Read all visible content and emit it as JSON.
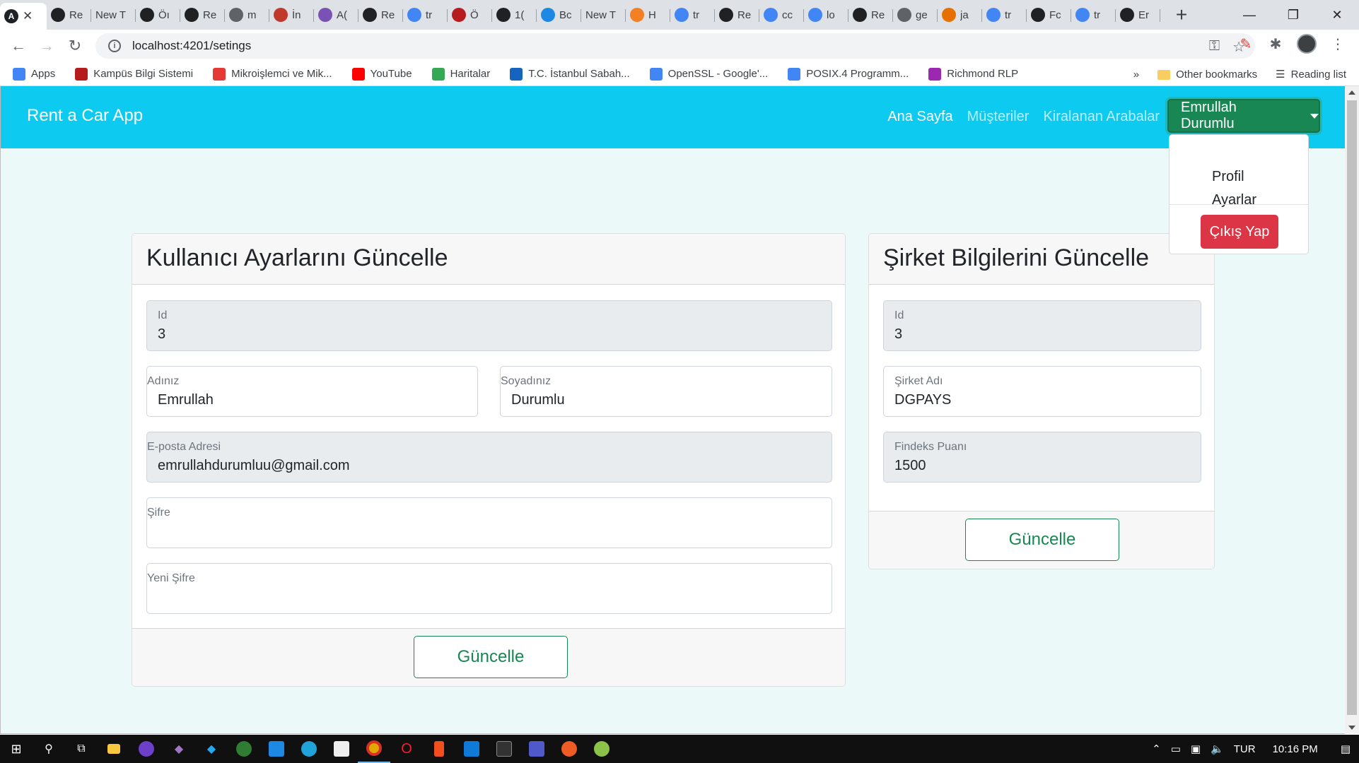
{
  "browser": {
    "tabs": [
      {
        "icon": "angular-icon",
        "label": "",
        "active": true
      },
      {
        "icon": "angular-icon",
        "label": "Re"
      },
      {
        "icon": "",
        "label": "New T"
      },
      {
        "icon": "frame-icon",
        "label": "Öı"
      },
      {
        "icon": "github-icon",
        "label": "Re"
      },
      {
        "icon": "globe-icon",
        "label": "m"
      },
      {
        "icon": "udemy-icon",
        "label": "İn"
      },
      {
        "icon": "bootstrap-icon",
        "label": "A("
      },
      {
        "icon": "angular-icon",
        "label": "Re"
      },
      {
        "icon": "google-icon",
        "label": "tr"
      },
      {
        "icon": "university-icon",
        "label": "Ö"
      },
      {
        "icon": "f-icon",
        "label": "1("
      },
      {
        "icon": "bd-icon",
        "label": "Bc"
      },
      {
        "icon": "",
        "label": "New T"
      },
      {
        "icon": "stack-icon",
        "label": "H"
      },
      {
        "icon": "google-icon",
        "label": "tr"
      },
      {
        "icon": "angular-icon",
        "label": "Re"
      },
      {
        "icon": "google-icon",
        "label": "cc"
      },
      {
        "icon": "google-icon",
        "label": "lo"
      },
      {
        "icon": "angular-icon",
        "label": "Re"
      },
      {
        "icon": "globe-icon",
        "label": "ge"
      },
      {
        "icon": "java-icon",
        "label": "ja"
      },
      {
        "icon": "google-icon",
        "label": "tr"
      },
      {
        "icon": "record-icon",
        "label": "Fc"
      },
      {
        "icon": "google-icon",
        "label": "tr"
      },
      {
        "icon": "angular-icon",
        "label": "Er"
      }
    ],
    "new_tab": "+",
    "url": "localhost:4201/setings",
    "bookmarks": [
      {
        "icon": "apps-icon",
        "label": "Apps"
      },
      {
        "icon": "university-icon",
        "label": "Kampüs Bilgi Sistemi"
      },
      {
        "icon": "chip-icon",
        "label": "Mikroişlemci ve Mik..."
      },
      {
        "icon": "youtube-icon",
        "label": "YouTube"
      },
      {
        "icon": "maps-icon",
        "label": "Haritalar"
      },
      {
        "icon": "otm-icon",
        "label": "T.C. İstanbul Sabah..."
      },
      {
        "icon": "google-icon",
        "label": "OpenSSL - Google'..."
      },
      {
        "icon": "google-icon",
        "label": "POSIX.4 Programm..."
      },
      {
        "icon": "richmond-icon",
        "label": "Richmond RLP"
      }
    ],
    "bookmarks_more": "»",
    "other_bookmarks": "Other bookmarks",
    "reading_list": "Reading list"
  },
  "app": {
    "brand": "Rent a Car App",
    "nav": [
      {
        "label": "Ana Sayfa",
        "active": true
      },
      {
        "label": "Müşteriler",
        "active": false
      },
      {
        "label": "Kiralanan Arabalar",
        "active": false
      }
    ],
    "user_menu": {
      "label": "Emrullah Durumlu",
      "items": [
        "Profil",
        "Ayarlar"
      ],
      "logout": "Çıkış Yap"
    },
    "user_card": {
      "title": "Kullanıcı Ayarlarını Güncelle",
      "id_label": "Id",
      "id_value": "3",
      "first_name_label": "Adınız",
      "first_name_value": "Emrullah",
      "last_name_label": "Soyadınız",
      "last_name_value": "Durumlu",
      "email_label": "E-posta Adresi",
      "email_value": "emrullahdurumluu@gmail.com",
      "password_label": "Şifre",
      "password_value": "",
      "new_password_label": "Yeni Şifre",
      "new_password_value": "",
      "submit": "Güncelle"
    },
    "company_card": {
      "title": "Şirket Bilgilerini Güncelle",
      "id_label": "Id",
      "id_value": "3",
      "company_name_label": "Şirket Adı",
      "company_name_value": "DGPAYS",
      "findeks_label": "Findeks Puanı",
      "findeks_value": "1500",
      "submit": "Güncelle"
    }
  },
  "taskbar": {
    "language": "TUR",
    "time": "10:16 PM"
  },
  "colors": {
    "navbar": "#0dcaf0",
    "page_bg": "#ebfaf8",
    "success": "#198754",
    "danger": "#dc3545"
  }
}
